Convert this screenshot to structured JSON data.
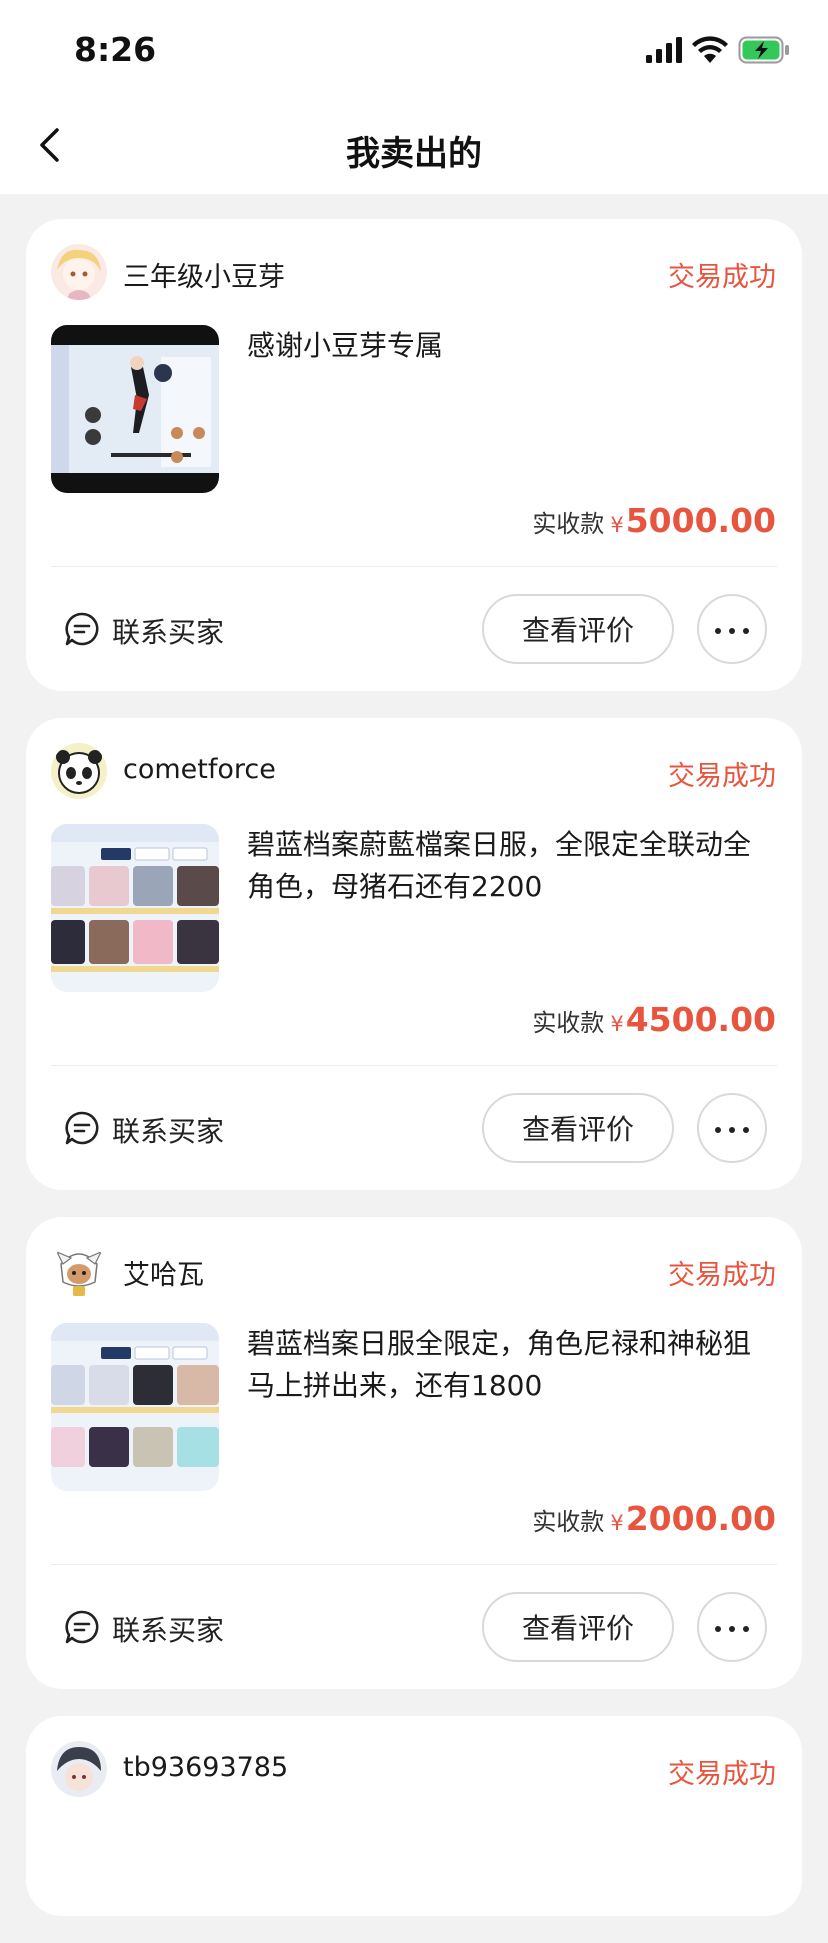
{
  "status_bar": {
    "time": "8:26",
    "icons": [
      "signal-icon",
      "wifi-icon",
      "battery-charging-icon"
    ],
    "battery_color": "#34c759"
  },
  "header": {
    "title": "我卖出的",
    "back_icon": "chevron-left-icon"
  },
  "colors": {
    "accent": "#e8553f",
    "background": "#f2f2f2",
    "card": "#ffffff"
  },
  "orders": [
    {
      "seller": "三年级小豆芽",
      "status": "交易成功",
      "title": "感谢小豆芽专属",
      "price_label": "实收款",
      "currency": "¥",
      "price": "5000.00",
      "contact_label": "联系买家",
      "review_label": "查看评价"
    },
    {
      "seller": "cometforce",
      "status": "交易成功",
      "title": "碧蓝档案蔚藍檔案日服，全限定全联动全角色，母猪石还有2200",
      "price_label": "实收款",
      "currency": "¥",
      "price": "4500.00",
      "contact_label": "联系买家",
      "review_label": "查看评价"
    },
    {
      "seller": "艾哈瓦",
      "status": "交易成功",
      "title": "碧蓝档案日服全限定，角色尼禄和神秘狙马上拼出来，还有1800",
      "price_label": "实收款",
      "currency": "¥",
      "price": "2000.00",
      "contact_label": "联系买家",
      "review_label": "查看评价"
    },
    {
      "seller": "tb93693785",
      "status": "交易成功"
    }
  ]
}
